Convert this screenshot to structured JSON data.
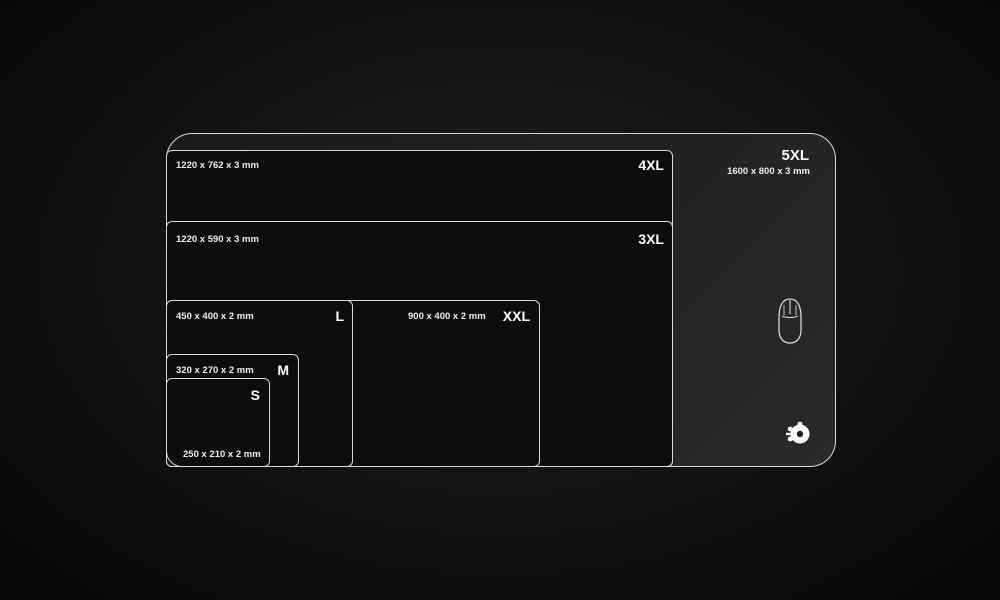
{
  "pads": {
    "xl5": {
      "size": "5XL",
      "dims": "1600 x 800 x 3 mm"
    },
    "xl4": {
      "size": "4XL",
      "dims": "1220 x 762 x 3 mm"
    },
    "xl3": {
      "size": "3XL",
      "dims": "1220 x 590 x 3 mm"
    },
    "xxl": {
      "size": "XXL",
      "dims": "900 x 400 x 2 mm"
    },
    "l": {
      "size": "L",
      "dims": "450 x 400 x 2 mm"
    },
    "m": {
      "size": "M",
      "dims": "320 x 270 x 2 mm"
    },
    "s": {
      "size": "S",
      "dims": "250 x 210 x 2 mm"
    }
  },
  "icons": {
    "mouse": "mouse-icon",
    "brand": "steelseries-logo-icon"
  },
  "colors": {
    "background": "#111111",
    "outline": "#d8d8d8",
    "text": "#ffffff"
  }
}
